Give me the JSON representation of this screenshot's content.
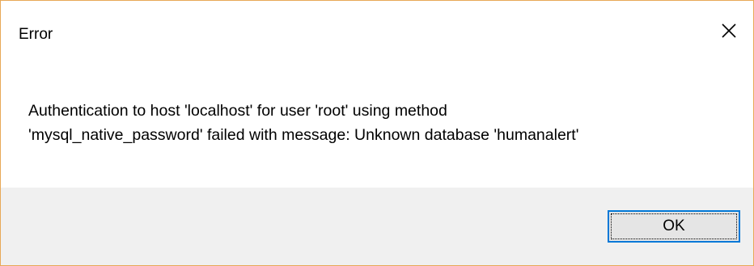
{
  "dialog": {
    "title": "Error",
    "close_icon": "close-icon",
    "message_lines": [
      "Authentication to host 'localhost' for user 'root' using method",
      "'mysql_native_password' failed with message: Unknown database 'humanalert'"
    ],
    "ok_label": "OK"
  },
  "colors": {
    "window_border": "#e8a857",
    "button_area_bg": "#f0f0f0",
    "ok_button_bg": "#e5e5e5",
    "ok_button_focus_border": "#0078d7"
  }
}
